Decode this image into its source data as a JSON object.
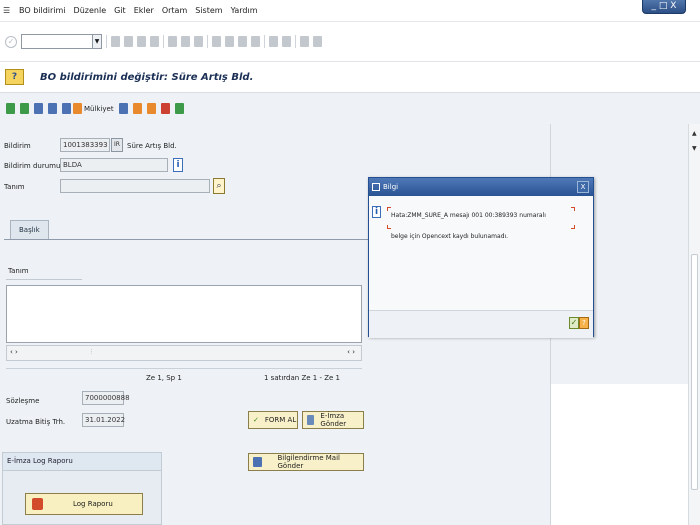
{
  "menu": {
    "system_icon": "list-icon",
    "items": [
      "BO bildirimi",
      "Düzenle",
      "Git",
      "Ekler",
      "Ortam",
      "Sistem",
      "Yardım"
    ]
  },
  "window": {
    "exit_label": "_ □ X"
  },
  "header": {
    "title": "BO bildirimini değiştir: Süre Artış Bld."
  },
  "app_toolbar": {
    "mulk_label": "Mülkiyet"
  },
  "form": {
    "bildirim_label": "Bildirim",
    "bildirim_value": "1001383393",
    "bildirim_type": "Süre Artış Bld.",
    "durum_label": "Bildirim durumu",
    "durum_value": "BLDA",
    "tanim_label": "Tanım"
  },
  "tab": {
    "basik_label": "Başlık"
  },
  "text_area": {
    "tanim_label": "Tanım"
  },
  "status": {
    "ze_sp": "Ze 1, Sp 1",
    "page_info": "1 satırdan Ze 1 - Ze 1"
  },
  "fields": {
    "sozlesme_label": "Sözleşme",
    "sozlesme_value": "7000000888",
    "uzatma_label": "Uzatma Bitiş Trh.",
    "uzatma_value": "31.01.2022"
  },
  "buttons": {
    "form_al": "FORM AL",
    "eimza_gonder": "E-İmza Gönder",
    "bilgilendirme": "Bilgilendirme Mail Gönder"
  },
  "log": {
    "header": "E-İmza Log Raporu",
    "button": "Log Raporu"
  },
  "dialog": {
    "title": "Bilgi",
    "close": "X",
    "message_line1": "Hata:ZMM_SURE_A mesajı 001 00:389393 numaralı",
    "message_line2": "belge için Opencext kaydı bulunamadı."
  },
  "colors": {
    "title_blue": "#2a5394",
    "accent_yellow": "#f8f0c0",
    "error_red": "#d24b2b"
  }
}
